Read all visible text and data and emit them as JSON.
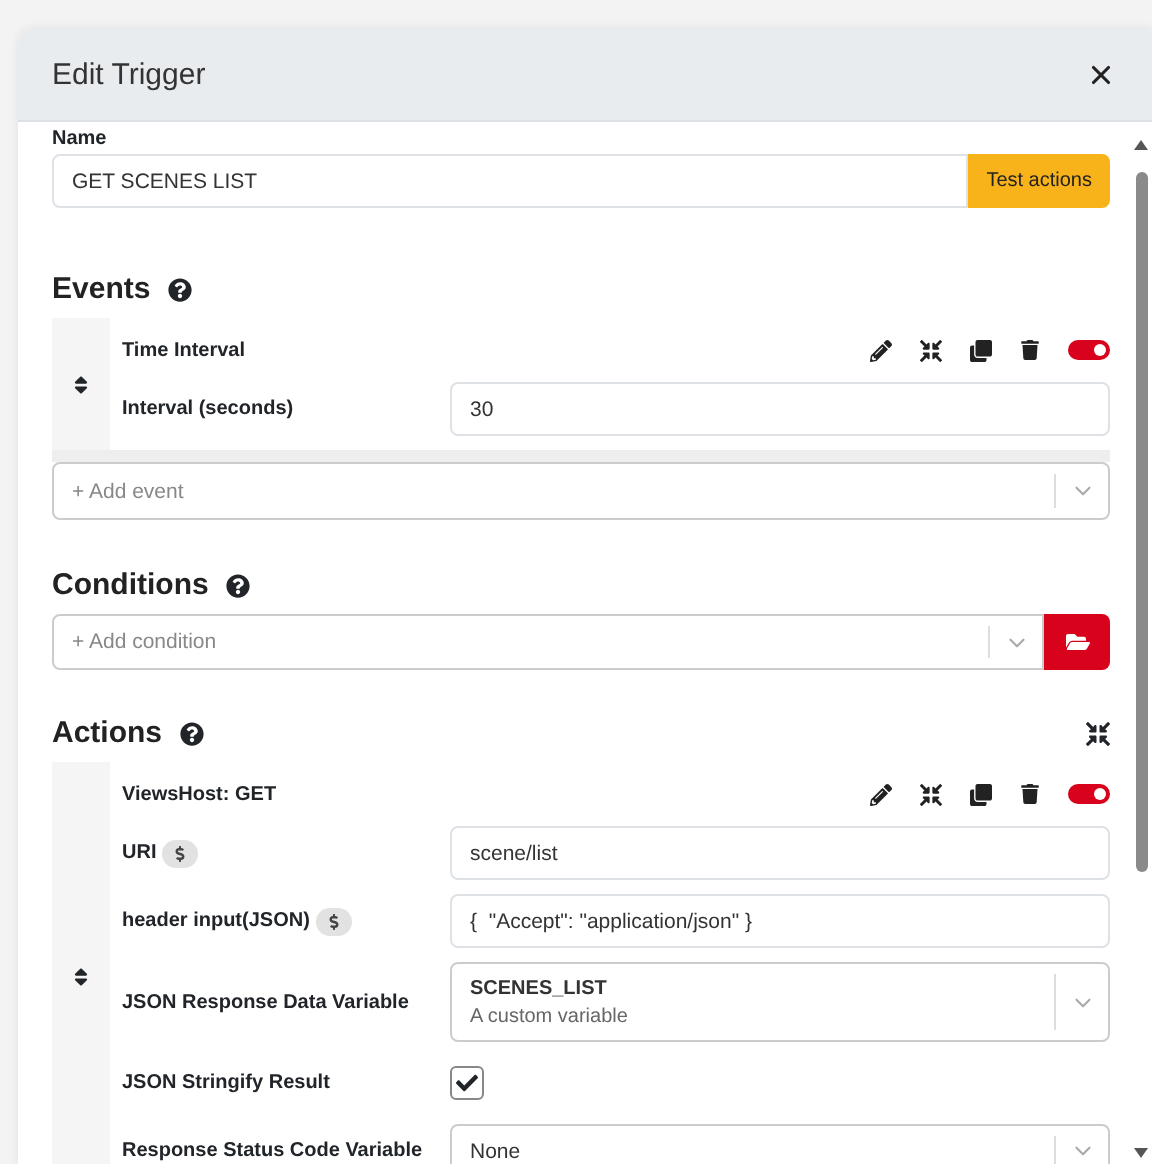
{
  "dialog": {
    "title": "Edit Trigger"
  },
  "name_field": {
    "label": "Name",
    "value": "GET SCENES LIST",
    "button": "Test actions"
  },
  "events": {
    "heading": "Events",
    "items": [
      {
        "title": "Time Interval",
        "enabled": true,
        "fields": [
          {
            "kind": "text",
            "label": "Interval (seconds)",
            "value": "30"
          }
        ]
      }
    ],
    "add_placeholder": "+ Add event"
  },
  "conditions": {
    "heading": "Conditions",
    "add_placeholder": "+ Add condition"
  },
  "actions": {
    "heading": "Actions",
    "items": [
      {
        "title": "ViewsHost: GET",
        "enabled": true,
        "fields": [
          {
            "kind": "text",
            "label": "URI",
            "variable": true,
            "value": "scene/list"
          },
          {
            "kind": "text",
            "label": "header input(JSON)",
            "variable": true,
            "value": "{  \"Accept\": \"application/json\" }"
          },
          {
            "kind": "select",
            "label": "JSON Response Data Variable",
            "value": "SCENES_LIST",
            "description": "A custom variable"
          },
          {
            "kind": "checkbox",
            "label": "JSON Stringify Result",
            "checked": true
          },
          {
            "kind": "select",
            "label": "Response Status Code Variable",
            "value": "None"
          }
        ]
      }
    ]
  }
}
